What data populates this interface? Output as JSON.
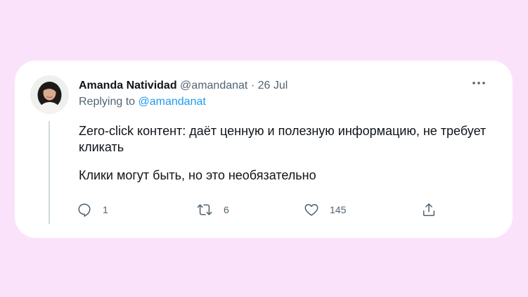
{
  "tweet": {
    "author_name": "Amanda Natividad",
    "handle": "@amandanat",
    "separator": "·",
    "date": "26 Jul",
    "replying_prefix": "Replying to",
    "replying_to": "@amandanat",
    "paragraphs": [
      "Zero-click контент: даёт ценную и полезную информацию, не требует кликать",
      "Клики могут быть, но это необязательно"
    ],
    "stats": {
      "replies": "1",
      "retweets": "6",
      "likes": "145"
    },
    "icons": {
      "reply": "reply-icon",
      "retweet": "retweet-icon",
      "like": "heart-icon",
      "share": "share-icon",
      "more": "more-icon",
      "avatar": "avatar"
    }
  },
  "colors": {
    "background": "#fbe2fb",
    "card": "#ffffff",
    "text": "#0f1419",
    "secondary_text": "#536471",
    "link": "#1d9bf0",
    "thread_line": "#cfd9de"
  }
}
